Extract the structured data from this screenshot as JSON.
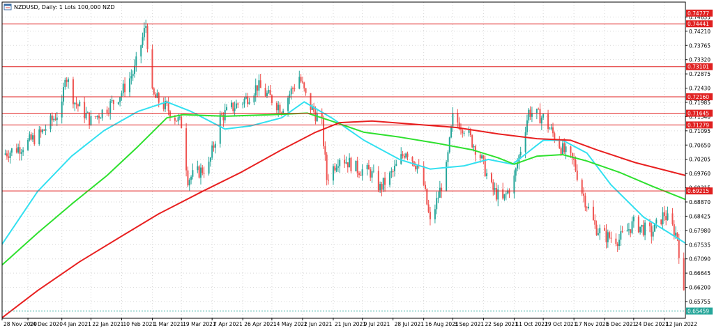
{
  "header": {
    "symbol_info": "NZDUSD, Daily:  1 Lots 100,000 NZD"
  },
  "colors": {
    "background": "#ffffff",
    "grid": "#d6d6d6",
    "candle_up": "#26a69a",
    "candle_down": "#ef5350",
    "ma_fast": "#33e0f0",
    "ma_mid": "#2ee02e",
    "ma_slow": "#e82020",
    "hline": "#e02020",
    "current_price_tag": "#26a69a"
  },
  "chart_data": {
    "type": "candlestick",
    "symbol": "NZDUSD",
    "timeframe": "Daily",
    "y_axis": {
      "min": 0.65232,
      "max": 0.75121,
      "ticks": [
        "0.74655",
        "0.74210",
        "0.73765",
        "0.73320",
        "0.72875",
        "0.72430",
        "0.71985",
        "0.71540",
        "0.71095",
        "0.70650",
        "0.70205",
        "0.69760",
        "0.69315",
        "0.68870",
        "0.68425",
        "0.67980",
        "0.67535",
        "0.67090",
        "0.66645",
        "0.66200",
        "0.65755"
      ]
    },
    "x_axis": {
      "start_date": "2020-11-28",
      "end_date": "2022-01-25",
      "tick_labels": [
        "28 Nov 2020",
        "14 Dec 2020",
        "4 Jan 2021",
        "22 Jan 2021",
        "10 Feb 2021",
        "1 Mar 2021",
        "19 Mar 2021",
        "7 Apr 2021",
        "26 Apr 2021",
        "14 May 2021",
        "2 Jun 2021",
        "21 Jun 2021",
        "9 Jul 2021",
        "28 Jul 2021",
        "16 Aug 2021",
        "3 Sep 2021",
        "22 Sep 2021",
        "11 Oct 2021",
        "29 Oct 2021",
        "17 Nov 2021",
        "6 Dec 2021",
        "24 Dec 2021",
        "12 Jan 2022"
      ]
    },
    "price_path": [
      [
        "2020-11-28",
        0.7035
      ],
      [
        "2020-12-10",
        0.706
      ],
      [
        "2020-12-22",
        0.71
      ],
      [
        "2021-01-04",
        0.718
      ],
      [
        "2021-01-06",
        0.729
      ],
      [
        "2021-01-12",
        0.72
      ],
      [
        "2021-01-22",
        0.714
      ],
      [
        "2021-02-05",
        0.72
      ],
      [
        "2021-02-10",
        0.723
      ],
      [
        "2021-02-18",
        0.73
      ],
      [
        "2021-02-25",
        0.744
      ],
      [
        "2021-03-01",
        0.722
      ],
      [
        "2021-03-10",
        0.718
      ],
      [
        "2021-03-19",
        0.713
      ],
      [
        "2021-03-23",
        0.696
      ],
      [
        "2021-04-05",
        0.7
      ],
      [
        "2021-04-12",
        0.715
      ],
      [
        "2021-04-19",
        0.718
      ],
      [
        "2021-04-28",
        0.721
      ],
      [
        "2021-05-05",
        0.725
      ],
      [
        "2021-05-20",
        0.718
      ],
      [
        "2021-05-31",
        0.728
      ],
      [
        "2021-06-05",
        0.72
      ],
      [
        "2021-06-14",
        0.713
      ],
      [
        "2021-06-17",
        0.696
      ],
      [
        "2021-06-25",
        0.703
      ],
      [
        "2021-07-06",
        0.699
      ],
      [
        "2021-07-14",
        0.698
      ],
      [
        "2021-07-20",
        0.693
      ],
      [
        "2021-07-28",
        0.698
      ],
      [
        "2021-08-05",
        0.705
      ],
      [
        "2021-08-12",
        0.7
      ],
      [
        "2021-08-16",
        0.694
      ],
      [
        "2021-08-20",
        0.682
      ],
      [
        "2021-08-30",
        0.699
      ],
      [
        "2021-09-03",
        0.715
      ],
      [
        "2021-09-10",
        0.712
      ],
      [
        "2021-09-20",
        0.703
      ],
      [
        "2021-09-27",
        0.693
      ],
      [
        "2021-10-04",
        0.689
      ],
      [
        "2021-10-11",
        0.696
      ],
      [
        "2021-10-20",
        0.717
      ],
      [
        "2021-10-29",
        0.715
      ],
      [
        "2021-11-04",
        0.71
      ],
      [
        "2021-11-10",
        0.705
      ],
      [
        "2021-11-17",
        0.701
      ],
      [
        "2021-11-22",
        0.692
      ],
      [
        "2021-11-30",
        0.681
      ],
      [
        "2021-12-06",
        0.678
      ],
      [
        "2021-12-15",
        0.677
      ],
      [
        "2021-12-24",
        0.682
      ],
      [
        "2022-01-04",
        0.679
      ],
      [
        "2022-01-12",
        0.685
      ],
      [
        "2022-01-20",
        0.678
      ],
      [
        "2022-01-25",
        0.6546
      ]
    ],
    "series": [
      {
        "color": "#33e0f0",
        "points": [
          [
            "2020-11-28",
            0.6755
          ],
          [
            "2020-12-20",
            0.692
          ],
          [
            "2021-01-10",
            0.703
          ],
          [
            "2021-01-30",
            0.711
          ],
          [
            "2021-02-20",
            0.717
          ],
          [
            "2021-03-10",
            0.72
          ],
          [
            "2021-03-25",
            0.717
          ],
          [
            "2021-04-15",
            0.7115
          ],
          [
            "2021-05-01",
            0.7125
          ],
          [
            "2021-05-20",
            0.715
          ],
          [
            "2021-06-03",
            0.72
          ],
          [
            "2021-06-20",
            0.715
          ],
          [
            "2021-07-10",
            0.708
          ],
          [
            "2021-08-01",
            0.702
          ],
          [
            "2021-08-20",
            0.699
          ],
          [
            "2021-09-10",
            0.7
          ],
          [
            "2021-09-25",
            0.702
          ],
          [
            "2021-10-10",
            0.7005
          ],
          [
            "2021-10-29",
            0.708
          ],
          [
            "2021-11-10",
            0.708
          ],
          [
            "2021-11-25",
            0.704
          ],
          [
            "2021-12-10",
            0.694
          ],
          [
            "2021-12-30",
            0.684
          ],
          [
            "2022-01-15",
            0.679
          ],
          [
            "2022-01-25",
            0.6758
          ]
        ]
      },
      {
        "color": "#2ee02e",
        "points": [
          [
            "2020-11-28",
            0.669
          ],
          [
            "2020-12-20",
            0.679
          ],
          [
            "2021-01-10",
            0.688
          ],
          [
            "2021-02-01",
            0.697
          ],
          [
            "2021-02-20",
            0.706
          ],
          [
            "2021-03-10",
            0.715
          ],
          [
            "2021-03-20",
            0.716
          ],
          [
            "2021-04-15",
            0.7155
          ],
          [
            "2021-05-15",
            0.716
          ],
          [
            "2021-06-05",
            0.7165
          ],
          [
            "2021-06-20",
            0.714
          ],
          [
            "2021-07-10",
            0.7105
          ],
          [
            "2021-08-01",
            0.709
          ],
          [
            "2021-08-25",
            0.707
          ],
          [
            "2021-09-15",
            0.705
          ],
          [
            "2021-10-01",
            0.7025
          ],
          [
            "2021-10-11",
            0.7005
          ],
          [
            "2021-10-25",
            0.703
          ],
          [
            "2021-11-10",
            0.7035
          ],
          [
            "2021-11-25",
            0.7015
          ],
          [
            "2021-12-15",
            0.698
          ],
          [
            "2022-01-05",
            0.6935
          ],
          [
            "2022-01-25",
            0.6895
          ]
        ]
      },
      {
        "color": "#e82020",
        "points": [
          [
            "2020-11-28",
            0.6525
          ],
          [
            "2020-12-20",
            0.661
          ],
          [
            "2021-01-15",
            0.67
          ],
          [
            "2021-02-10",
            0.678
          ],
          [
            "2021-03-05",
            0.685
          ],
          [
            "2021-04-01",
            0.692
          ],
          [
            "2021-04-25",
            0.698
          ],
          [
            "2021-05-20",
            0.705
          ],
          [
            "2021-06-10",
            0.7105
          ],
          [
            "2021-06-25",
            0.7135
          ],
          [
            "2021-07-15",
            0.714
          ],
          [
            "2021-08-10",
            0.713
          ],
          [
            "2021-09-05",
            0.712
          ],
          [
            "2021-10-01",
            0.71
          ],
          [
            "2021-10-25",
            0.7085
          ],
          [
            "2021-11-15",
            0.708
          ],
          [
            "2021-12-01",
            0.705
          ],
          [
            "2021-12-25",
            0.701
          ],
          [
            "2022-01-25",
            0.697
          ]
        ]
      }
    ],
    "horizontal_lines": [
      {
        "price": 0.74441,
        "label": "0.74441"
      },
      {
        "price": 0.73101,
        "label": "0.73101"
      },
      {
        "price": 0.7216,
        "label": "0.72160"
      },
      {
        "price": 0.71645,
        "label": "0.71645"
      },
      {
        "price": 0.71279,
        "label": "0.71279"
      },
      {
        "price": 0.69215,
        "label": "0.69215"
      }
    ],
    "top_tag": {
      "price": 0.74777,
      "label": "0.74777"
    },
    "current_price": {
      "price": 0.65459,
      "label": "0.65459"
    }
  }
}
